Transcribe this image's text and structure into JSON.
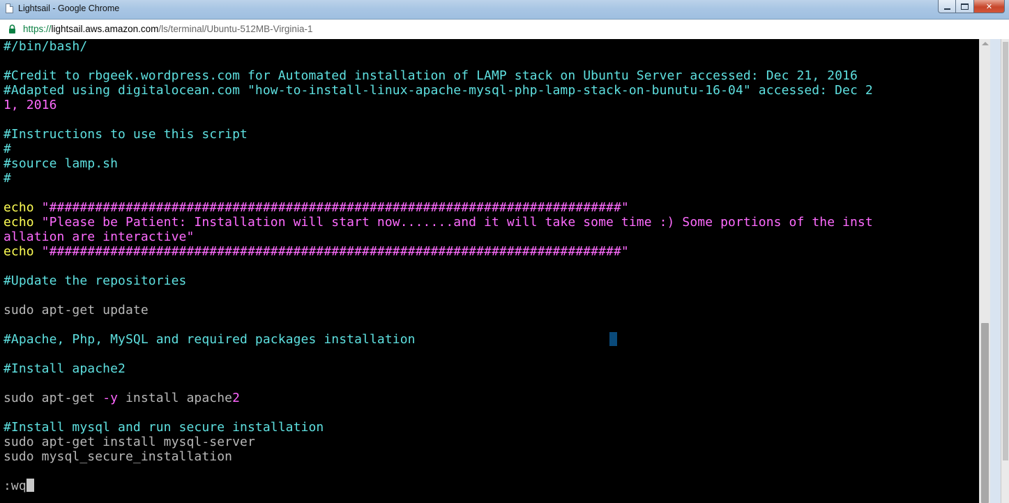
{
  "window": {
    "title": "Lightsail - Google Chrome"
  },
  "address_bar": {
    "scheme": "https://",
    "host": "lightsail.aws.amazon.com",
    "path": "/ls/terminal/Ubuntu-512MB-Virginia-1"
  },
  "terminal": {
    "lines": {
      "l01": "#/bin/bash/",
      "l03": "#Credit to rbgeek.wordpress.com for Automated installation of LAMP stack on Ubuntu Server accessed: Dec 21, 2016",
      "l04": "#Adapted using digitalocean.com \"how-to-install-linux-apache-mysql-php-lamp-stack-on-bunutu-16-04\" accessed: Dec 2",
      "l05": "1, 2016",
      "l07": "#Instructions to use this script",
      "l08": "#",
      "l09": "#source lamp.sh",
      "l10": "#",
      "l12_kw": "echo",
      "l12_str": " \"###########################################################################\"",
      "l13_kw": "echo",
      "l13_str": " \"Please be Patient: Installation will start now.......and it will take some time :) Some portions of the inst",
      "l14": "allation are interactive\"",
      "l15_kw": "echo",
      "l15_str": " \"###########################################################################\"",
      "l17": "#Update the repositories",
      "l19": "sudo apt-get update",
      "l21": "#Apache, Php, MySQL and required packages installation",
      "l23": "#Install apache2",
      "l25_a": "sudo apt-get ",
      "l25_b": "-y",
      "l25_c": " install apache",
      "l25_d": "2",
      "l27": "#Install mysql and run secure installation",
      "l28": "sudo apt-get install mysql-server",
      "l29": "sudo mysql_secure_installation",
      "l31": ":wq"
    }
  },
  "colors": {
    "comment": "#5ee0e0",
    "string": "#ff6bff",
    "keyword": "#ffff55",
    "plain": "#b8b8b8"
  }
}
